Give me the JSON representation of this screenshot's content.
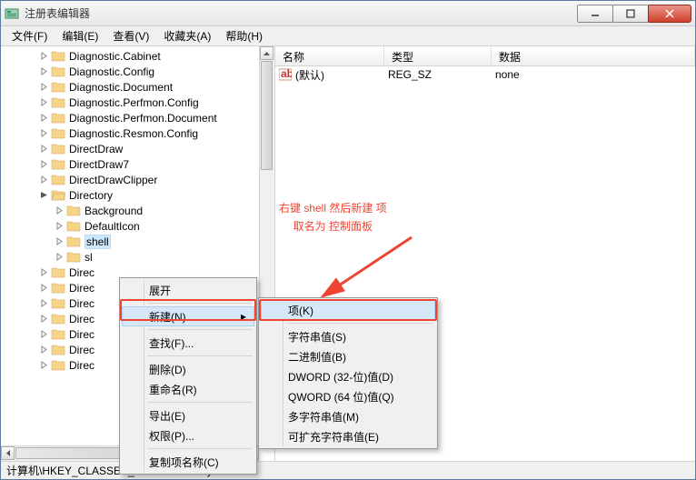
{
  "window": {
    "title": "注册表编辑器"
  },
  "menubar": {
    "items": [
      "文件(F)",
      "编辑(E)",
      "查看(V)",
      "收藏夹(A)",
      "帮助(H)"
    ]
  },
  "tree": {
    "items": [
      "Diagnostic.Cabinet",
      "Diagnostic.Config",
      "Diagnostic.Document",
      "Diagnostic.Perfmon.Config",
      "Diagnostic.Perfmon.Document",
      "Diagnostic.Resmon.Config",
      "DirectDraw",
      "DirectDraw7",
      "DirectDrawClipper"
    ],
    "expanded": {
      "label": "Directory",
      "children": [
        "Background",
        "DefaultIcon",
        "shell",
        "sl"
      ]
    },
    "tail": [
      "Direc",
      "Direc",
      "Direc",
      "Direc",
      "Direc",
      "Direc",
      "Direc"
    ],
    "selected": "shell"
  },
  "list": {
    "columns": {
      "name": "名称",
      "type": "类型",
      "data": "数据"
    },
    "rows": [
      {
        "name": "(默认)",
        "type": "REG_SZ",
        "data": "none"
      }
    ]
  },
  "context1": {
    "items": [
      "展开",
      "新建(N)",
      "查找(F)...",
      "删除(D)",
      "重命名(R)",
      "导出(E)",
      "权限(P)...",
      "复制项名称(C)"
    ],
    "hover": "新建(N)"
  },
  "context2": {
    "items": [
      "项(K)",
      "字符串值(S)",
      "二进制值(B)",
      "DWORD (32-位)值(D)",
      "QWORD (64 位)值(Q)",
      "多字符串值(M)",
      "可扩充字符串值(E)"
    ],
    "hover": "项(K)"
  },
  "annotation": {
    "line1": "右键 shell 然后新建 项",
    "line2": "取名为 控制面板"
  },
  "statusbar": {
    "path": "计算机\\HKEY_CLASSES_ROOT\\Directory\\shell"
  }
}
